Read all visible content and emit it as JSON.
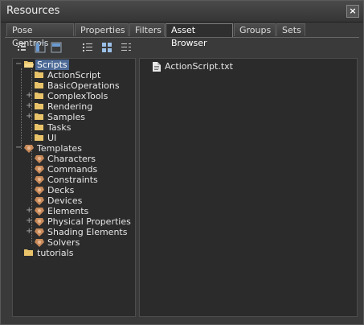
{
  "window": {
    "title": "Resources"
  },
  "tabs": [
    {
      "label": "Pose Controls"
    },
    {
      "label": "Properties"
    },
    {
      "label": "Filters"
    },
    {
      "label": "Asset Browser"
    },
    {
      "label": "Groups"
    },
    {
      "label": "Sets"
    }
  ],
  "active_tab": "Asset Browser",
  "toolbar": {
    "buttons": [
      "tree-view-icon",
      "split-vertical-icon",
      "split-horizontal-icon",
      "list-view-icon",
      "icon-view-icon",
      "detail-view-icon"
    ]
  },
  "tree": {
    "items": [
      {
        "label": "Scripts",
        "icon": "folder-open-icon",
        "selected": true
      },
      {
        "label": "ActionScript",
        "icon": "folder-icon"
      },
      {
        "label": "BasicOperations",
        "icon": "folder-icon"
      },
      {
        "label": "ComplexTools",
        "icon": "folder-icon",
        "expander": "+"
      },
      {
        "label": "Rendering",
        "icon": "folder-icon",
        "expander": "+"
      },
      {
        "label": "Samples",
        "icon": "folder-icon",
        "expander": "+"
      },
      {
        "label": "Tasks",
        "icon": "folder-icon"
      },
      {
        "label": "UI",
        "icon": "folder-icon"
      },
      {
        "label": "Templates",
        "icon": "template-icon",
        "expander": "−"
      },
      {
        "label": "Characters",
        "icon": "template-icon"
      },
      {
        "label": "Commands",
        "icon": "template-icon"
      },
      {
        "label": "Constraints",
        "icon": "template-icon"
      },
      {
        "label": "Decks",
        "icon": "template-icon"
      },
      {
        "label": "Devices",
        "icon": "template-icon"
      },
      {
        "label": "Elements",
        "icon": "template-icon",
        "expander": "+"
      },
      {
        "label": "Physical Properties",
        "icon": "template-icon",
        "expander": "+"
      },
      {
        "label": "Shading Elements",
        "icon": "template-icon",
        "expander": "+"
      },
      {
        "label": "Solvers",
        "icon": "template-icon"
      },
      {
        "label": "tutorials",
        "icon": "folder-icon"
      }
    ]
  },
  "files": [
    {
      "label": "ActionScript.txt",
      "icon": "text-file-icon"
    }
  ],
  "colors": {
    "selection": "#4d6a96",
    "folder": "#e8c36a",
    "template": "#c98a5a"
  }
}
